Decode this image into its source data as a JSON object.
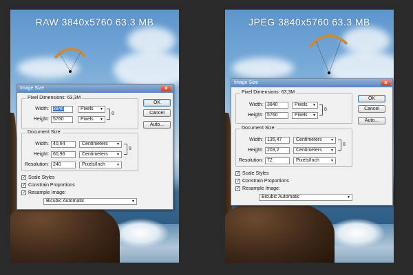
{
  "panels": [
    {
      "caption": "RAW 3840x5760 63.3 MB",
      "dialog": {
        "title": "Image Size",
        "close_symbol": "x",
        "pixel_dimensions_label": "Pixel Dimensions:",
        "pixel_dimensions_value": "63,3M",
        "width_label": "Width:",
        "width_value": "3840",
        "width_unit": "Pixels",
        "height_label": "Height:",
        "height_value": "5760",
        "height_unit": "Pixels",
        "document_size_label": "Document Size:",
        "doc_width_label": "Width:",
        "doc_width_value": "40,64",
        "doc_width_unit": "Centimeters",
        "doc_height_label": "Height:",
        "doc_height_value": "60,96",
        "doc_height_unit": "Centimeters",
        "resolution_label": "Resolution:",
        "resolution_value": "240",
        "resolution_unit": "Pixels/Inch",
        "scale_styles": "Scale Styles",
        "constrain_proportions": "Constrain Proportions",
        "resample_image": "Resample Image:",
        "resample_method": "Bicubic Automatic",
        "ok_label": "OK",
        "cancel_label": "Cancel",
        "auto_label": "Auto..."
      }
    },
    {
      "caption": "JPEG 3840x5760 63.3 MB",
      "dialog": {
        "title": "Image Size",
        "close_symbol": "x",
        "pixel_dimensions_label": "Pixel Dimensions:",
        "pixel_dimensions_value": "63,3M",
        "width_label": "Width:",
        "width_value": "3840",
        "width_unit": "Pixels",
        "height_label": "Height:",
        "height_value": "5760",
        "height_unit": "Pixels",
        "document_size_label": "Document Size:",
        "doc_width_label": "Width:",
        "doc_width_value": "135,47",
        "doc_width_unit": "Centimeters",
        "doc_height_label": "Height:",
        "doc_height_value": "203,2",
        "doc_height_unit": "Centimeters",
        "resolution_label": "Resolution:",
        "resolution_value": "72",
        "resolution_unit": "Pixels/Inch",
        "scale_styles": "Scale Styles",
        "constrain_proportions": "Constrain Proportions",
        "resample_image": "Resample Image:",
        "resample_method": "Bicubic Automatic",
        "ok_label": "OK",
        "cancel_label": "Cancel",
        "auto_label": "Auto..."
      }
    }
  ],
  "icons": {
    "dropdown": "chevron-down-icon",
    "chain_link": "chain-link-icon",
    "checkbox": "checkbox-checked-icon",
    "close": "close-icon"
  },
  "colors": {
    "titlebar": "#5a86bd",
    "selection": "#3a6fc4",
    "background": "#2a2a2a"
  }
}
